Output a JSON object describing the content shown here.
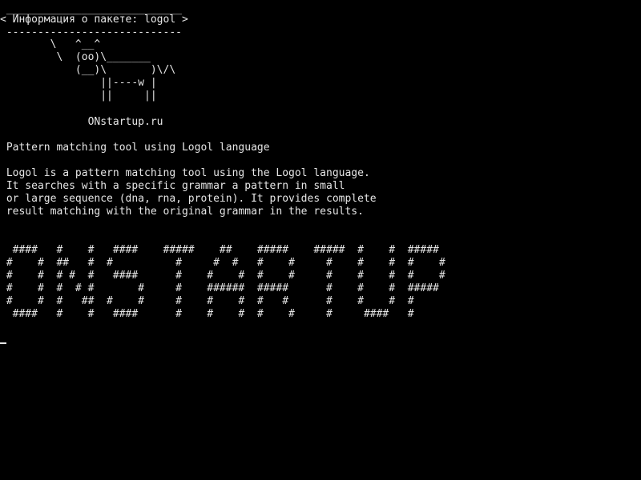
{
  "terminal": {
    "bubble": {
      "top_border": " ____________________________",
      "text": "< Информация о пакете: logol >",
      "bottom_border": " ----------------------------"
    },
    "cow": [
      "        \\   ^__^",
      "         \\  (oo)\\_______",
      "            (__)\\       )\\/\\",
      "                ||----w |",
      "                ||     ||"
    ],
    "site": "              ONstartup.ru",
    "summary": " Pattern matching tool using Logol language",
    "description": [
      " Logol is a pattern matching tool using the Logol language.",
      " It searches with a specific grammar a pattern in small",
      " or large sequence (dna, rna, protein). It provides complete",
      " result matching with the original grammar in the results."
    ],
    "banner": [
      "  ####   #    #   ####    #####    ##    #####    #####  #    #  #####",
      " #    #  ##   #  #          #     #  #   #    #     #    #    #  #    #",
      " #    #  # #  #   ####      #    #    #  #    #     #    #    #  #    #",
      " #    #  #  # #       #     #    ######  #####      #    #    #  #####",
      " #    #  #   ##  #    #     #    #    #  #   #      #    #    #  #",
      "  ####   #    #   ####      #    #    #  #    #     #     ####   #"
    ],
    "colors": {
      "background": "#000000",
      "foreground": "#e6e6e6"
    }
  }
}
